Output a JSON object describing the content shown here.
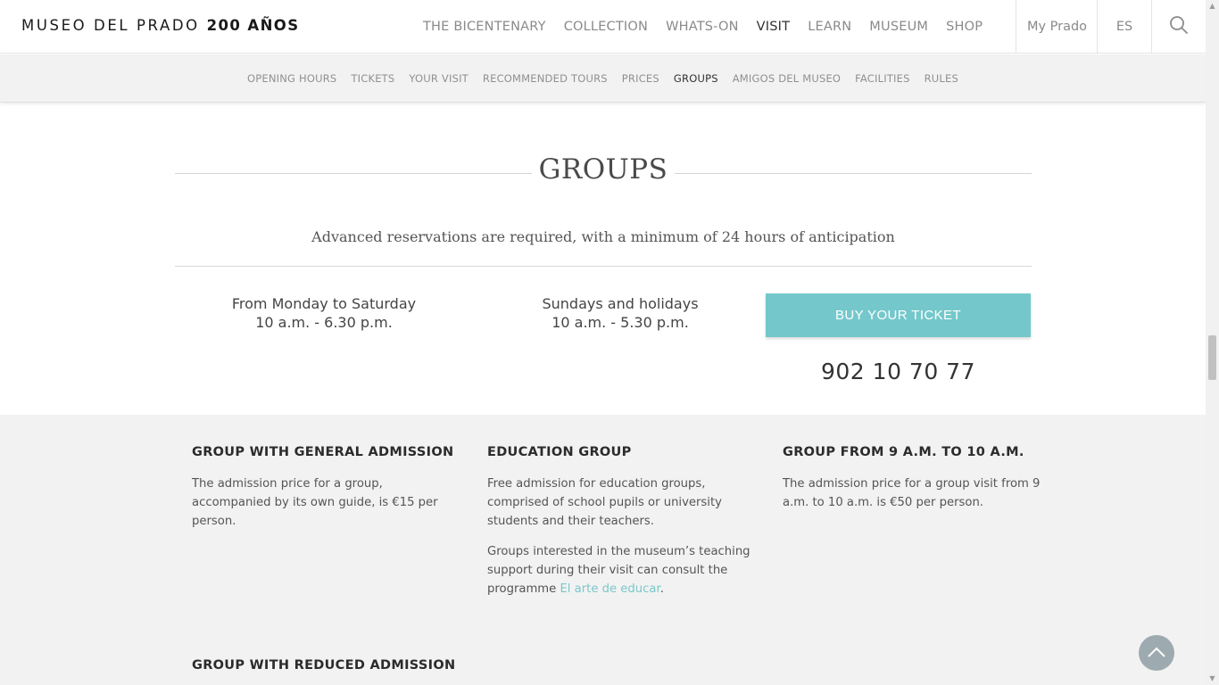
{
  "header": {
    "logo_text": "MUSEO DEL PRADO",
    "logo_bold": "200 AÑOS",
    "nav": [
      {
        "label": "THE BICENTENARY",
        "active": false
      },
      {
        "label": "COLLECTION",
        "active": false
      },
      {
        "label": "WHATS-ON",
        "active": false
      },
      {
        "label": "VISIT",
        "active": true
      },
      {
        "label": "LEARN",
        "active": false
      },
      {
        "label": "MUSEUM",
        "active": false
      },
      {
        "label": "SHOP",
        "active": false
      }
    ],
    "my_prado": "My Prado",
    "language": "ES",
    "search_icon": "search-icon"
  },
  "subnav": [
    {
      "label": "OPENING HOURS",
      "active": false
    },
    {
      "label": "TICKETS",
      "active": false
    },
    {
      "label": "YOUR VISIT",
      "active": false
    },
    {
      "label": "RECOMMENDED TOURS",
      "active": false
    },
    {
      "label": "PRICES",
      "active": false
    },
    {
      "label": "GROUPS",
      "active": true
    },
    {
      "label": "AMIGOS DEL MUSEO",
      "active": false
    },
    {
      "label": "FACILITIES",
      "active": false
    },
    {
      "label": "RULES",
      "active": false
    }
  ],
  "groups": {
    "title": "GROUPS",
    "subtitle": "Advanced reservations are required, with a minimum of 24 hours of anticipation",
    "hours": [
      {
        "days": "From Monday to Saturday",
        "time": "10 a.m. - 6.30 p.m."
      },
      {
        "days": "Sundays and holidays",
        "time": "10 a.m. - 5.30 p.m."
      }
    ],
    "buy_button": "BUY YOUR TICKET",
    "phone": "902 10 70 77"
  },
  "cards": [
    {
      "title": "GROUP WITH GENERAL ADMISSION",
      "text": "The admission price for a group, accompanied by its own guide, is €15 per person."
    },
    {
      "title": "EDUCATION GROUP",
      "text": "Free admission for education groups, comprised of school pupils or university students and their teachers.",
      "text2_before": "Groups interested in the museum’s teaching support during their visit can consult the programme ",
      "link": "El arte de educar",
      "text2_after": "."
    },
    {
      "title": "GROUP FROM 9 A.M. TO 10 A.M.",
      "text": "The admission price for a group visit from 9 a.m. to 10 a.m. is €50 per person."
    },
    {
      "title": "GROUP WITH REDUCED ADMISSION"
    }
  ],
  "colors": {
    "accent": "#74c8cb",
    "link": "#7cc7cb",
    "grey_section": "#f2f2f2"
  },
  "scroll_to_top_icon": "chevron-up-icon"
}
